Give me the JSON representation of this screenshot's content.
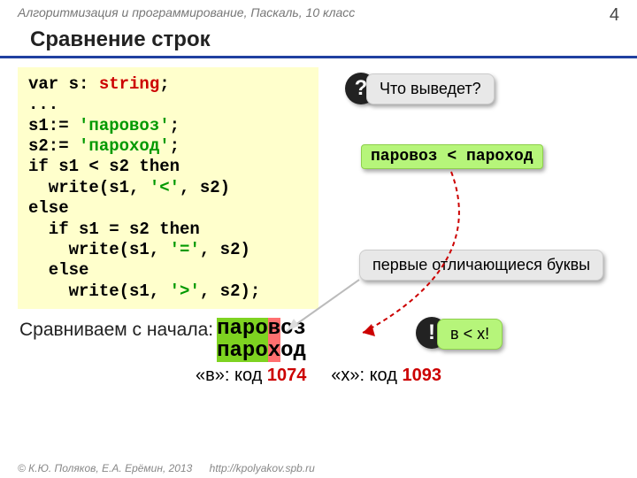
{
  "header": {
    "course": "Алгоритмизация и программирование, Паскаль, 10 класс",
    "page": "4"
  },
  "title": "Сравнение строк",
  "code": {
    "l1_a": "var s: ",
    "l1_type": "string",
    "l1_b": ";",
    "l2": "...",
    "l3_a": "s1:= ",
    "l3_s": "'паровоз'",
    "l3_b": ";",
    "l4_a": "s2:= ",
    "l4_s": "'пароход'",
    "l4_b": ";",
    "l5": "if s1 < s2 then",
    "l6_a": "  write(s1, ",
    "l6_s": "'<'",
    "l6_b": ", s2)",
    "l7": "else",
    "l8": "  if s1 = s2 then",
    "l9_a": "    write(s1, ",
    "l9_s": "'='",
    "l9_b": ", s2)",
    "l10": "  else",
    "l11_a": "    write(s1, ",
    "l11_s": "'>'",
    "l11_b": ", s2);"
  },
  "callouts": {
    "question_symbol": "?",
    "question_text": "Что выведет?",
    "result": "паровоз < пароход",
    "first_diff": "первые отличающиеся буквы",
    "bang_symbol": "!",
    "bang_text": "в < х!"
  },
  "compare": {
    "label": "Сравниваем с начала:",
    "w1_g": "паро",
    "w1_r": "в",
    "w1_p": "оз",
    "w2_g": "паро",
    "w2_r": "х",
    "w2_p": "од"
  },
  "codes": {
    "a_label": "«в»: код ",
    "a_val": "1074",
    "gap": "   ",
    "b_label": "«х»: код ",
    "b_val": "1093"
  },
  "footer": {
    "copyright": "© К.Ю. Поляков, Е.А. Ерёмин, 2013",
    "url": "http://kpolyakov.spb.ru"
  }
}
